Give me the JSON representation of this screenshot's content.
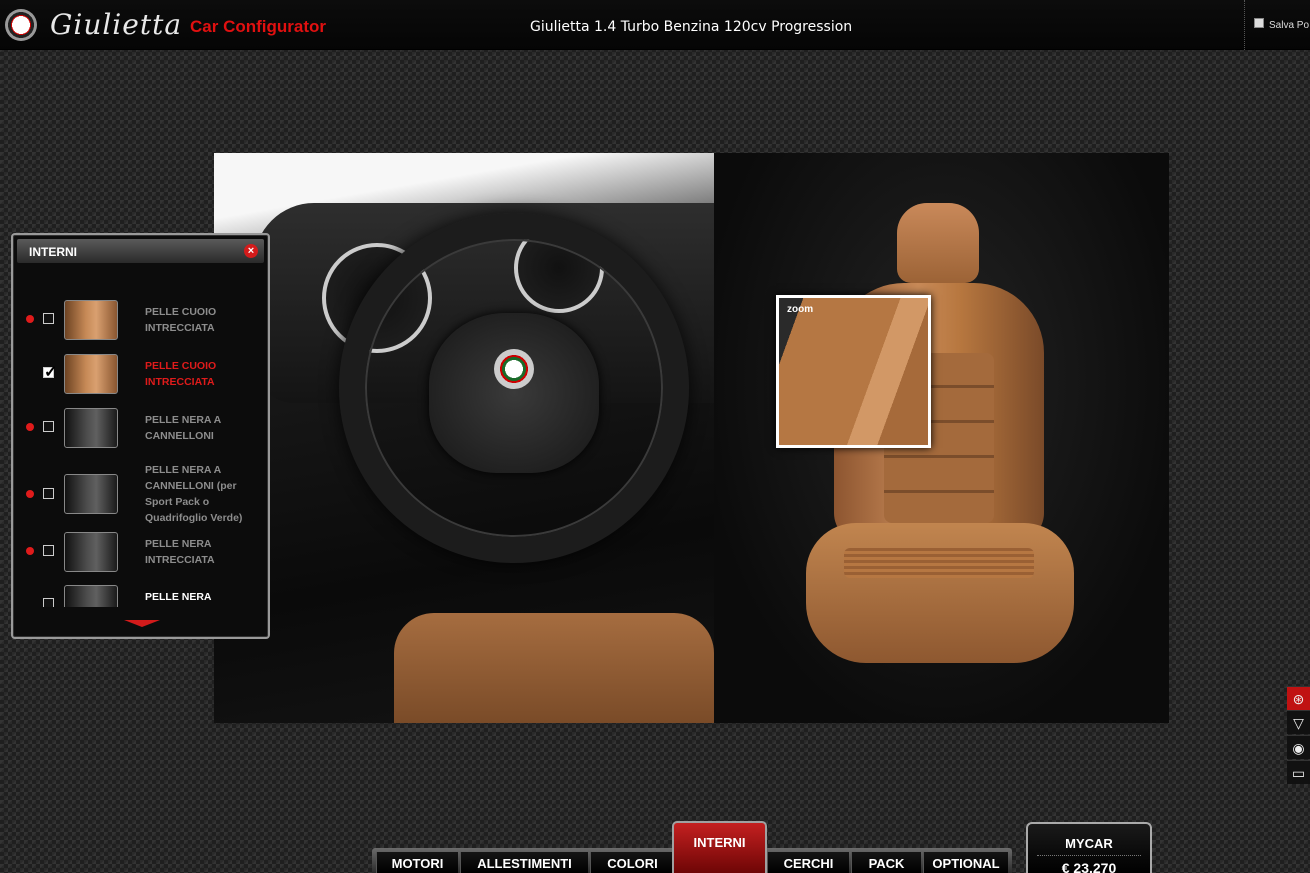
{
  "header": {
    "brand": "Giulietta",
    "configurator_label": "Car Configurator",
    "model": "Giulietta 1.4 Turbo Benzina 120cv Progression",
    "save_label": "Salva Po"
  },
  "zoom": {
    "label": "zoom"
  },
  "panel": {
    "title": "INTERNI",
    "close": "×",
    "options": [
      {
        "label": "PELLE CUOIO INTRECCIATA",
        "selected": false,
        "has_dot": true,
        "swatch": "tan"
      },
      {
        "label": "PELLE CUOIO INTRECCIATA",
        "selected": true,
        "has_dot": false,
        "swatch": "tan"
      },
      {
        "label": "PELLE NERA A CANNELLONI",
        "selected": false,
        "has_dot": true,
        "swatch": "black"
      },
      {
        "label": "PELLE NERA A CANNELLONI (per Sport Pack o Quadrifoglio Verde)",
        "selected": false,
        "has_dot": true,
        "swatch": "black"
      },
      {
        "label": "PELLE NERA INTRECCIATA",
        "selected": false,
        "has_dot": true,
        "swatch": "black"
      },
      {
        "label": "PELLE NERA",
        "selected": false,
        "has_dot": false,
        "swatch": "black"
      }
    ]
  },
  "tools": [
    {
      "icon": "steering-wheel-icon",
      "glyph": "⊛",
      "active": true
    },
    {
      "icon": "grille-icon",
      "glyph": "▽",
      "active": false
    },
    {
      "icon": "eye-icon",
      "glyph": "◉",
      "active": false
    },
    {
      "icon": "fullscreen-icon",
      "glyph": "▭",
      "active": false
    }
  ],
  "tabs": {
    "motori": "MOTORI",
    "allestimenti": "ALLESTIMENTI",
    "colori": "COLORI",
    "interni": "INTERNI",
    "cerchi": "CERCHI",
    "pack": "PACK",
    "optional": "OPTIONAL"
  },
  "mycar": {
    "label": "MYCAR",
    "price": "€ 23.270"
  },
  "colors": {
    "accent": "#e01010",
    "panel_bg": "#0c0c0c",
    "active_tab": "#c42020"
  }
}
